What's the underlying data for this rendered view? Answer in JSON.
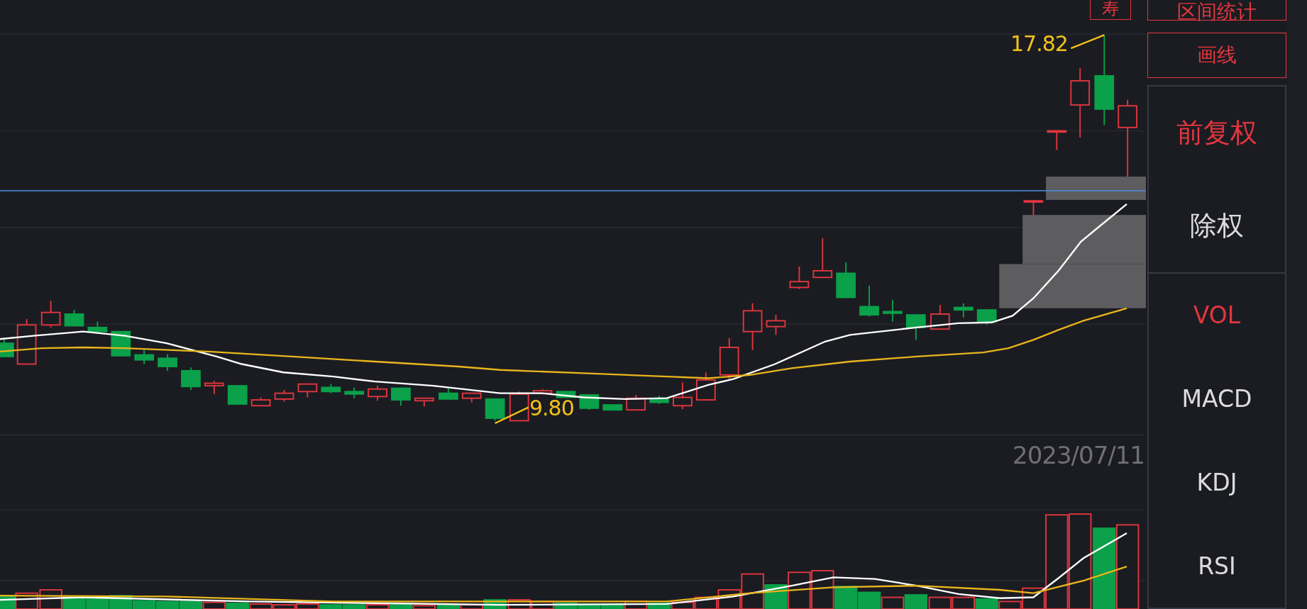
{
  "chart": {
    "high_label": "17.82",
    "low_label": "9.80",
    "date": "2023/07/11",
    "overlay_button": "寿"
  },
  "tool_buttons": [
    "区间统计",
    "画线"
  ],
  "adjust_options": [
    {
      "label": "前复权",
      "selected": true
    },
    {
      "label": "除权",
      "selected": false
    }
  ],
  "indicators": [
    {
      "label": "VOL",
      "selected": true
    },
    {
      "label": "MACD",
      "selected": false
    },
    {
      "label": "KDJ",
      "selected": false
    },
    {
      "label": "RSI",
      "selected": false
    }
  ]
}
